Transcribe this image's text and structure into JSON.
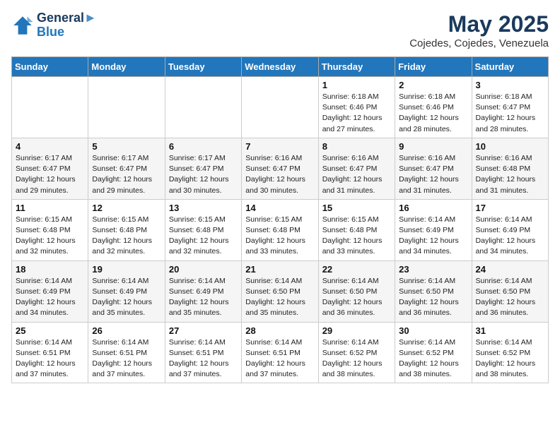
{
  "header": {
    "logo_line1": "General",
    "logo_line2": "Blue",
    "month_title": "May 2025",
    "location": "Cojedes, Cojedes, Venezuela"
  },
  "weekdays": [
    "Sunday",
    "Monday",
    "Tuesday",
    "Wednesday",
    "Thursday",
    "Friday",
    "Saturday"
  ],
  "weeks": [
    [
      {
        "day": "",
        "info": ""
      },
      {
        "day": "",
        "info": ""
      },
      {
        "day": "",
        "info": ""
      },
      {
        "day": "",
        "info": ""
      },
      {
        "day": "1",
        "info": "Sunrise: 6:18 AM\nSunset: 6:46 PM\nDaylight: 12 hours\nand 27 minutes."
      },
      {
        "day": "2",
        "info": "Sunrise: 6:18 AM\nSunset: 6:46 PM\nDaylight: 12 hours\nand 28 minutes."
      },
      {
        "day": "3",
        "info": "Sunrise: 6:18 AM\nSunset: 6:47 PM\nDaylight: 12 hours\nand 28 minutes."
      }
    ],
    [
      {
        "day": "4",
        "info": "Sunrise: 6:17 AM\nSunset: 6:47 PM\nDaylight: 12 hours\nand 29 minutes."
      },
      {
        "day": "5",
        "info": "Sunrise: 6:17 AM\nSunset: 6:47 PM\nDaylight: 12 hours\nand 29 minutes."
      },
      {
        "day": "6",
        "info": "Sunrise: 6:17 AM\nSunset: 6:47 PM\nDaylight: 12 hours\nand 30 minutes."
      },
      {
        "day": "7",
        "info": "Sunrise: 6:16 AM\nSunset: 6:47 PM\nDaylight: 12 hours\nand 30 minutes."
      },
      {
        "day": "8",
        "info": "Sunrise: 6:16 AM\nSunset: 6:47 PM\nDaylight: 12 hours\nand 31 minutes."
      },
      {
        "day": "9",
        "info": "Sunrise: 6:16 AM\nSunset: 6:47 PM\nDaylight: 12 hours\nand 31 minutes."
      },
      {
        "day": "10",
        "info": "Sunrise: 6:16 AM\nSunset: 6:48 PM\nDaylight: 12 hours\nand 31 minutes."
      }
    ],
    [
      {
        "day": "11",
        "info": "Sunrise: 6:15 AM\nSunset: 6:48 PM\nDaylight: 12 hours\nand 32 minutes."
      },
      {
        "day": "12",
        "info": "Sunrise: 6:15 AM\nSunset: 6:48 PM\nDaylight: 12 hours\nand 32 minutes."
      },
      {
        "day": "13",
        "info": "Sunrise: 6:15 AM\nSunset: 6:48 PM\nDaylight: 12 hours\nand 32 minutes."
      },
      {
        "day": "14",
        "info": "Sunrise: 6:15 AM\nSunset: 6:48 PM\nDaylight: 12 hours\nand 33 minutes."
      },
      {
        "day": "15",
        "info": "Sunrise: 6:15 AM\nSunset: 6:48 PM\nDaylight: 12 hours\nand 33 minutes."
      },
      {
        "day": "16",
        "info": "Sunrise: 6:14 AM\nSunset: 6:49 PM\nDaylight: 12 hours\nand 34 minutes."
      },
      {
        "day": "17",
        "info": "Sunrise: 6:14 AM\nSunset: 6:49 PM\nDaylight: 12 hours\nand 34 minutes."
      }
    ],
    [
      {
        "day": "18",
        "info": "Sunrise: 6:14 AM\nSunset: 6:49 PM\nDaylight: 12 hours\nand 34 minutes."
      },
      {
        "day": "19",
        "info": "Sunrise: 6:14 AM\nSunset: 6:49 PM\nDaylight: 12 hours\nand 35 minutes."
      },
      {
        "day": "20",
        "info": "Sunrise: 6:14 AM\nSunset: 6:49 PM\nDaylight: 12 hours\nand 35 minutes."
      },
      {
        "day": "21",
        "info": "Sunrise: 6:14 AM\nSunset: 6:50 PM\nDaylight: 12 hours\nand 35 minutes."
      },
      {
        "day": "22",
        "info": "Sunrise: 6:14 AM\nSunset: 6:50 PM\nDaylight: 12 hours\nand 36 minutes."
      },
      {
        "day": "23",
        "info": "Sunrise: 6:14 AM\nSunset: 6:50 PM\nDaylight: 12 hours\nand 36 minutes."
      },
      {
        "day": "24",
        "info": "Sunrise: 6:14 AM\nSunset: 6:50 PM\nDaylight: 12 hours\nand 36 minutes."
      }
    ],
    [
      {
        "day": "25",
        "info": "Sunrise: 6:14 AM\nSunset: 6:51 PM\nDaylight: 12 hours\nand 37 minutes."
      },
      {
        "day": "26",
        "info": "Sunrise: 6:14 AM\nSunset: 6:51 PM\nDaylight: 12 hours\nand 37 minutes."
      },
      {
        "day": "27",
        "info": "Sunrise: 6:14 AM\nSunset: 6:51 PM\nDaylight: 12 hours\nand 37 minutes."
      },
      {
        "day": "28",
        "info": "Sunrise: 6:14 AM\nSunset: 6:51 PM\nDaylight: 12 hours\nand 37 minutes."
      },
      {
        "day": "29",
        "info": "Sunrise: 6:14 AM\nSunset: 6:52 PM\nDaylight: 12 hours\nand 38 minutes."
      },
      {
        "day": "30",
        "info": "Sunrise: 6:14 AM\nSunset: 6:52 PM\nDaylight: 12 hours\nand 38 minutes."
      },
      {
        "day": "31",
        "info": "Sunrise: 6:14 AM\nSunset: 6:52 PM\nDaylight: 12 hours\nand 38 minutes."
      }
    ]
  ]
}
